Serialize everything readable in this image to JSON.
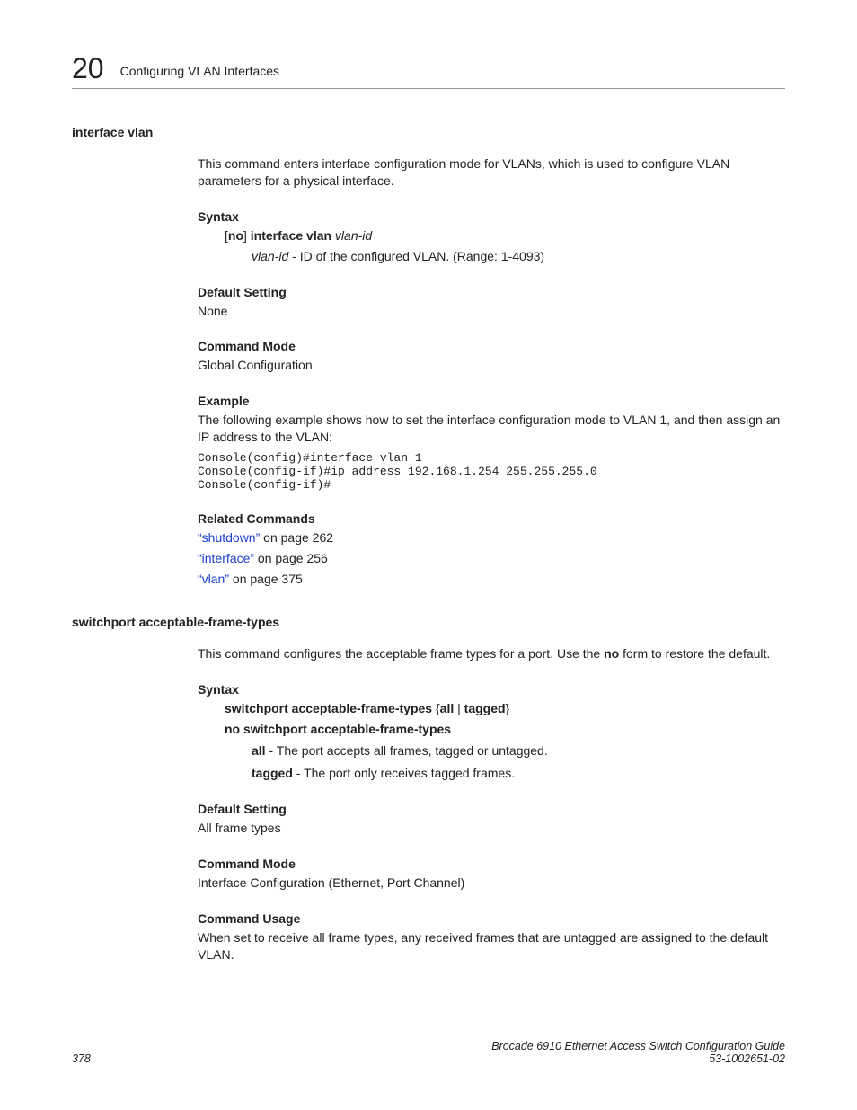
{
  "header": {
    "chapter_number": "20",
    "chapter_title": "Configuring VLAN Interfaces"
  },
  "cmd1": {
    "name": "interface vlan",
    "description": "This command enters interface configuration mode for VLANs, which is used to configure VLAN parameters for a physical interface.",
    "syntax_label": "Syntax",
    "syntax_bracket_open": "[",
    "syntax_no": "no",
    "syntax_bracket_close": "] ",
    "syntax_cmd": "interface vlan",
    "syntax_arg": " vlan-id",
    "arg_name": "vlan-id",
    "arg_desc": " - ID of the configured VLAN. (Range: 1-4093)",
    "default_label": "Default Setting",
    "default_value": "None",
    "mode_label": "Command Mode",
    "mode_value": "Global Configuration",
    "example_label": "Example",
    "example_desc": "The following example shows how to set the interface configuration mode to VLAN 1, and then assign an IP address to the VLAN:",
    "example_code": "Console(config)#interface vlan 1\nConsole(config-if)#ip address 192.168.1.254 255.255.255.0\nConsole(config-if)#",
    "related_label": "Related Commands",
    "related": {
      "r1_link": "“shutdown”",
      "r1_rest": " on page 262",
      "r2_link": "“interface”",
      "r2_rest": " on page 256",
      "r3_link": "“vlan”",
      "r3_rest": " on page 375"
    }
  },
  "cmd2": {
    "name": "switchport acceptable-frame-types",
    "description_pre": "This command configures the acceptable frame types for a port. Use the ",
    "description_bold": "no",
    "description_post": " form to restore the default.",
    "syntax_label": "Syntax",
    "syntax_cmd": "switchport acceptable-frame-types",
    "syntax_brace_open": " {",
    "syntax_opt1": "all",
    "syntax_pipe": " | ",
    "syntax_opt2": "tagged",
    "syntax_brace_close": "}",
    "syntax_no": "no switchport acceptable-frame-types",
    "opt_all_name": "all",
    "opt_all_desc": " - The port accepts all frames, tagged or untagged.",
    "opt_tagged_name": "tagged",
    "opt_tagged_desc": " - The port only receives tagged frames.",
    "default_label": "Default Setting",
    "default_value": "All frame types",
    "mode_label": "Command Mode",
    "mode_value": "Interface Configuration (Ethernet, Port Channel)",
    "usage_label": "Command Usage",
    "usage_value": "When set to receive all frame types, any received frames that are untagged are assigned to the default VLAN."
  },
  "footer": {
    "page_number": "378",
    "doc_title": "Brocade 6910 Ethernet Access Switch Configuration Guide",
    "doc_number": "53-1002651-02"
  }
}
